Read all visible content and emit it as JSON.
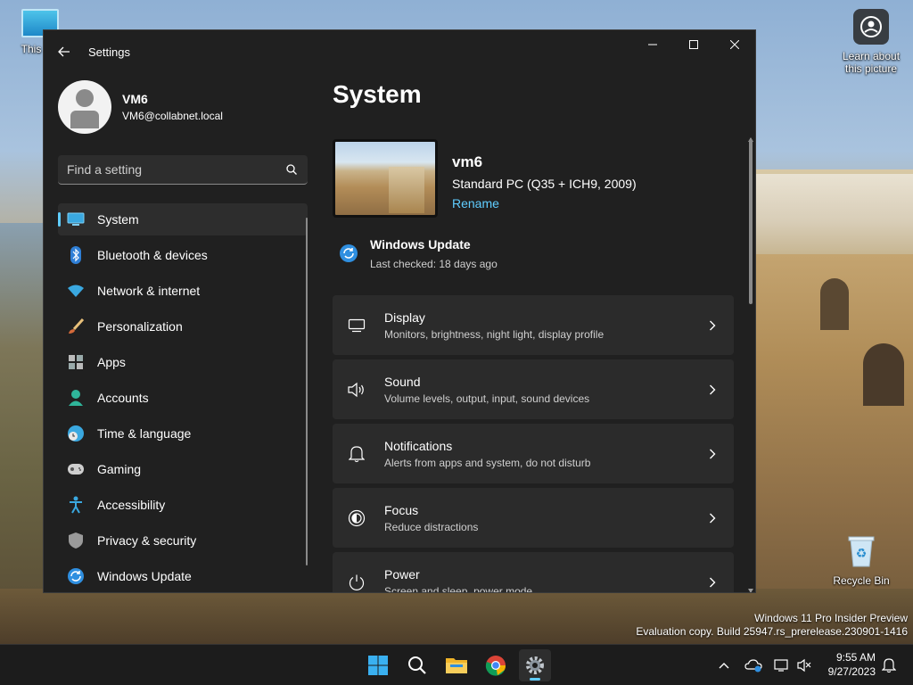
{
  "desktop": {
    "icons": {
      "this_pc": "This PC",
      "learn_about": "Learn about\nthis picture",
      "recycle_bin": "Recycle Bin"
    },
    "watermark": {
      "line1": "Windows 11 Pro Insider Preview",
      "line2": "Evaluation copy. Build 25947.rs_prerelease.230901-1416"
    }
  },
  "window": {
    "title": "Settings",
    "controls": {
      "minimize": "minimize",
      "maximize": "maximize",
      "close": "close"
    }
  },
  "profile": {
    "name": "VM6",
    "email": "VM6@collabnet.local"
  },
  "search": {
    "placeholder": "Find a setting"
  },
  "nav": {
    "items": [
      {
        "label": "System",
        "icon": "monitor-icon",
        "active": true
      },
      {
        "label": "Bluetooth & devices",
        "icon": "bluetooth-icon"
      },
      {
        "label": "Network & internet",
        "icon": "wifi-icon"
      },
      {
        "label": "Personalization",
        "icon": "brush-icon"
      },
      {
        "label": "Apps",
        "icon": "apps-icon"
      },
      {
        "label": "Accounts",
        "icon": "person-icon"
      },
      {
        "label": "Time & language",
        "icon": "globe-clock-icon"
      },
      {
        "label": "Gaming",
        "icon": "gamepad-icon"
      },
      {
        "label": "Accessibility",
        "icon": "accessibility-icon"
      },
      {
        "label": "Privacy & security",
        "icon": "shield-icon"
      },
      {
        "label": "Windows Update",
        "icon": "update-icon"
      }
    ]
  },
  "main": {
    "title": "System",
    "device": {
      "name": "vm6",
      "model": "Standard PC (Q35 + ICH9, 2009)",
      "rename": "Rename"
    },
    "windows_update": {
      "title": "Windows Update",
      "subtitle": "Last checked: 18 days ago"
    },
    "cards": [
      {
        "title": "Display",
        "subtitle": "Monitors, brightness, night light, display profile",
        "icon": "display-icon"
      },
      {
        "title": "Sound",
        "subtitle": "Volume levels, output, input, sound devices",
        "icon": "speaker-icon"
      },
      {
        "title": "Notifications",
        "subtitle": "Alerts from apps and system, do not disturb",
        "icon": "bell-icon"
      },
      {
        "title": "Focus",
        "subtitle": "Reduce distractions",
        "icon": "focus-icon"
      },
      {
        "title": "Power",
        "subtitle": "Screen and sleep, power mode",
        "icon": "power-icon"
      }
    ]
  },
  "taskbar": {
    "apps": [
      "start-icon",
      "search-icon",
      "file-explorer-icon",
      "chrome-icon",
      "settings-icon"
    ],
    "clock": {
      "time": "9:55 AM",
      "date": "9/27/2023"
    }
  },
  "colors": {
    "accent": "#60cdff",
    "window_bg": "#202020",
    "card_bg": "#2b2b2b"
  }
}
